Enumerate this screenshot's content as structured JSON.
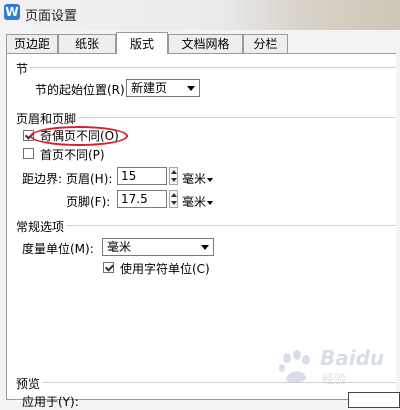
{
  "window": {
    "title": "页面设置",
    "app_icon_letter": "W"
  },
  "tabs": [
    {
      "label": "页边距",
      "active": false
    },
    {
      "label": "纸张",
      "active": false
    },
    {
      "label": "版式",
      "active": true
    },
    {
      "label": "文档网格",
      "active": false
    },
    {
      "label": "分栏",
      "active": false
    }
  ],
  "section": {
    "title": "节",
    "start_label": "节的起始位置(R):",
    "start_value": "新建页"
  },
  "header_footer": {
    "title": "页眉和页脚",
    "odd_even_label": "奇偶页不同(O)",
    "odd_even_checked": true,
    "first_page_label": "首页不同(P)",
    "first_page_checked": false,
    "margin_label": "距边界:",
    "header_label": "页眉(H):",
    "header_value": "15",
    "header_unit": "毫米",
    "footer_label": "页脚(F):",
    "footer_value": "17.5",
    "footer_unit": "毫米"
  },
  "general": {
    "title": "常规选项",
    "measure_label": "度量单位(M):",
    "measure_value": "毫米",
    "char_unit_label": "使用字符单位(C)",
    "char_unit_checked": true
  },
  "preview": {
    "title": "预览",
    "apply_label": "应用于(Y):"
  },
  "watermark": {
    "brand": "Baidu",
    "sub": "经验"
  },
  "colors": {
    "annotation": "#d8202a",
    "app_icon": "#2f7bd8"
  }
}
